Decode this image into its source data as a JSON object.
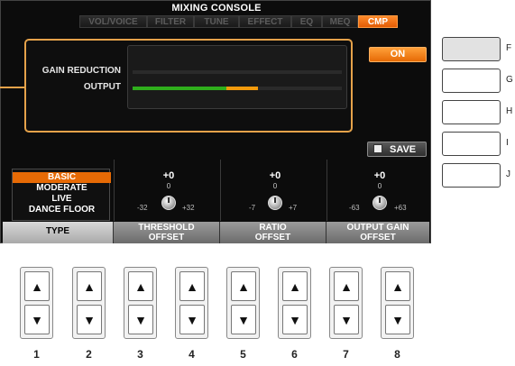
{
  "screen": {
    "title": "MIXING CONSOLE",
    "tabs": [
      {
        "label": "VOL/VOICE",
        "active": false
      },
      {
        "label": "FILTER",
        "active": false
      },
      {
        "label": "TUNE",
        "active": false
      },
      {
        "label": "EFFECT",
        "active": false
      },
      {
        "label": "EQ",
        "active": false
      },
      {
        "label": "MEQ",
        "active": false
      },
      {
        "label": "CMP",
        "active": true
      }
    ],
    "gain_reduction_label": "GAIN REDUCTION",
    "output_label": "OUTPUT",
    "gain_reduction_level": 0.0,
    "output_level_green": 0.45,
    "output_level_orange": 0.15,
    "on_label": "ON",
    "save_label": "SAVE",
    "type_list": [
      {
        "label": "BASIC",
        "selected": true
      },
      {
        "label": "MODERATE",
        "selected": false
      },
      {
        "label": "LIVE",
        "selected": false
      },
      {
        "label": "DANCE FLOOR",
        "selected": false
      }
    ],
    "params": [
      {
        "value": "+0",
        "zero": "0",
        "min": "-32",
        "max": "+32",
        "label1": "THRESHOLD",
        "label2": "OFFSET"
      },
      {
        "value": "+0",
        "zero": "0",
        "min": "-7",
        "max": "+7",
        "label1": "RATIO",
        "label2": "OFFSET"
      },
      {
        "value": "+0",
        "zero": "0",
        "min": "-63",
        "max": "+63",
        "label1": "OUTPUT GAIN",
        "label2": "OFFSET"
      }
    ],
    "type_footer": "TYPE",
    "colors": {
      "accent": "#e66a05",
      "frame": "#e5a24a",
      "meter_green": "#2fae1c",
      "meter_orange": "#f29a0c"
    }
  },
  "side_buttons": [
    {
      "label": "F",
      "pressed": true
    },
    {
      "label": "G",
      "pressed": false
    },
    {
      "label": "H",
      "pressed": false
    },
    {
      "label": "I",
      "pressed": false
    },
    {
      "label": "J",
      "pressed": false
    }
  ],
  "bottom_buttons": {
    "up_icon": "▲",
    "down_icon": "▼",
    "numbers": [
      "1",
      "2",
      "3",
      "4",
      "5",
      "6",
      "7",
      "8"
    ]
  }
}
